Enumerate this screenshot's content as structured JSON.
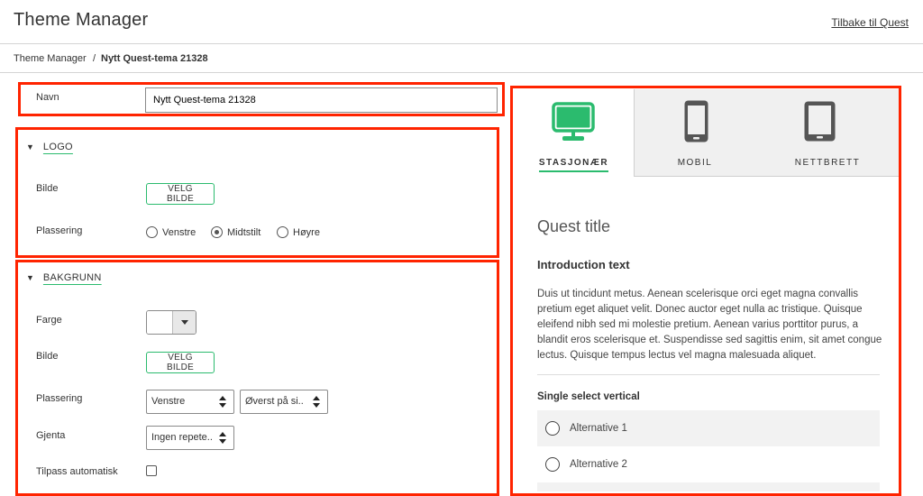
{
  "header": {
    "title": "Theme Manager",
    "back_link": "Tilbake til Quest"
  },
  "breadcrumb": {
    "root": "Theme Manager",
    "separator": "/",
    "current": "Nytt Quest-tema 21328"
  },
  "name_field": {
    "label": "Navn",
    "value": "Nytt Quest-tema 21328"
  },
  "logo_section": {
    "title": "LOGO",
    "image_label": "Bilde",
    "image_button": "VELG BILDE",
    "placement_label": "Plassering",
    "placement_options": [
      "Venstre",
      "Midtstilt",
      "Høyre"
    ],
    "placement_selected": "Midtstilt"
  },
  "background_section": {
    "title": "BAKGRUNN",
    "color_label": "Farge",
    "color_value": "#ffffff",
    "image_label": "Bilde",
    "image_button": "VELG BILDE",
    "placement_label": "Plassering",
    "placement_h": "Venstre",
    "placement_v": "Øverst på si..",
    "repeat_label": "Gjenta",
    "repeat_value": "Ingen repete..",
    "autofit_label": "Tilpass automatisk",
    "autofit_checked": false
  },
  "preview": {
    "tabs": [
      {
        "label": "STASJONÆR",
        "icon": "desktop-icon",
        "active": true
      },
      {
        "label": "MOBIL",
        "icon": "mobile-icon",
        "active": false
      },
      {
        "label": "NETTBRETT",
        "icon": "tablet-icon",
        "active": false
      }
    ],
    "quest_title": "Quest title",
    "intro_heading": "Introduction text",
    "intro_body": "Duis ut tincidunt metus. Aenean scelerisque orci eget magna convallis pretium eget aliquet velit. Donec auctor eget nulla ac tristique. Quisque eleifend nibh sed mi molestie pretium. Aenean varius porttitor purus, a blandit eros scelerisque et. Suspendisse sed sagittis enim, sit amet congue lectus. Quisque tempus lectus vel magna malesuada aliquet.",
    "question": "Single select vertical",
    "alternatives": [
      "Alternative 1",
      "Alternative 2"
    ]
  },
  "colors": {
    "accent": "#2bbb6e",
    "highlight_box": "#ff2400",
    "device_icon_inactive": "#555555"
  }
}
